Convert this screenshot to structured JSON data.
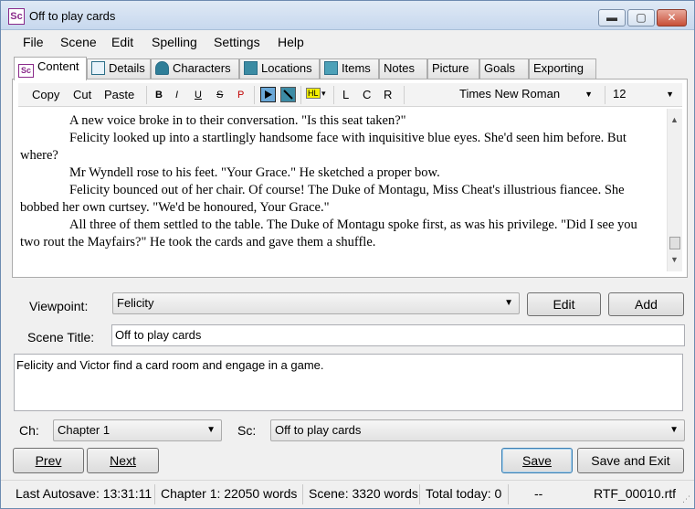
{
  "window": {
    "icon_text": "Sc",
    "title": "Off to play cards",
    "min": "▬",
    "max": "▢",
    "close": "✕"
  },
  "menu": [
    "File",
    "Scene",
    "Edit",
    "Spelling",
    "Settings",
    "Help"
  ],
  "tabs": [
    {
      "label": "Content",
      "icon": "sc-icon",
      "active": true
    },
    {
      "label": "Details",
      "icon": "details-icon"
    },
    {
      "label": "Characters",
      "icon": "characters-icon"
    },
    {
      "label": "Locations",
      "icon": "locations-icon"
    },
    {
      "label": "Items",
      "icon": "items-icon"
    },
    {
      "label": "Notes"
    },
    {
      "label": "Picture"
    },
    {
      "label": "Goals"
    },
    {
      "label": "Exporting"
    }
  ],
  "toolbar": {
    "copy": "Copy",
    "cut": "Cut",
    "paste": "Paste",
    "bold": "B",
    "italic": "I",
    "underline": "U",
    "strike": "S",
    "p": "P",
    "highlight": "HL",
    "align_left": "L",
    "align_center": "C",
    "align_right": "R",
    "font": "Times New Roman",
    "size": "12"
  },
  "editor": {
    "paragraphs": [
      "A new voice broke in to their conversation. \"Is this seat taken?\"",
      "Felicity looked up into a startlingly handsome face with inquisitive blue eyes. She'd seen him before.  But where?",
      "Mr Wyndell rose to his feet. \"Your Grace.\" He sketched a proper bow.",
      "Felicity bounced out of her chair.  Of course!  The Duke of Montagu, Miss Cheat's illustrious fiancee.  She bobbed her own curtsey.  \"We'd be honoured, Your Grace.\"",
      "All three of them settled to the table.  The Duke of Montagu spoke first, as was his privilege.  \"Did I see you two rout the Mayfairs?\"  He took the cards and gave them a shuffle."
    ]
  },
  "viewpoint": {
    "label": "Viewpoint:",
    "value": "Felicity",
    "edit": "Edit",
    "add": "Add"
  },
  "scene_title": {
    "label": "Scene Title:",
    "value": "Off to play cards"
  },
  "summary": "Felicity and Victor find a card room and engage in a game.",
  "chapter": {
    "label": "Ch:",
    "value": "Chapter 1"
  },
  "scene": {
    "label": "Sc:",
    "value": "Off to play cards"
  },
  "buttons": {
    "prev": "Prev",
    "next": "Next",
    "save": "Save",
    "save_exit": "Save and Exit"
  },
  "status": {
    "autosave": "Last Autosave: 13:31:11",
    "chapter_words": "Chapter 1: 22050 words",
    "scene_words": "Scene: 3320 words",
    "total_today": "Total today: 0",
    "dash": "--",
    "file": "RTF_00010.rtf"
  }
}
